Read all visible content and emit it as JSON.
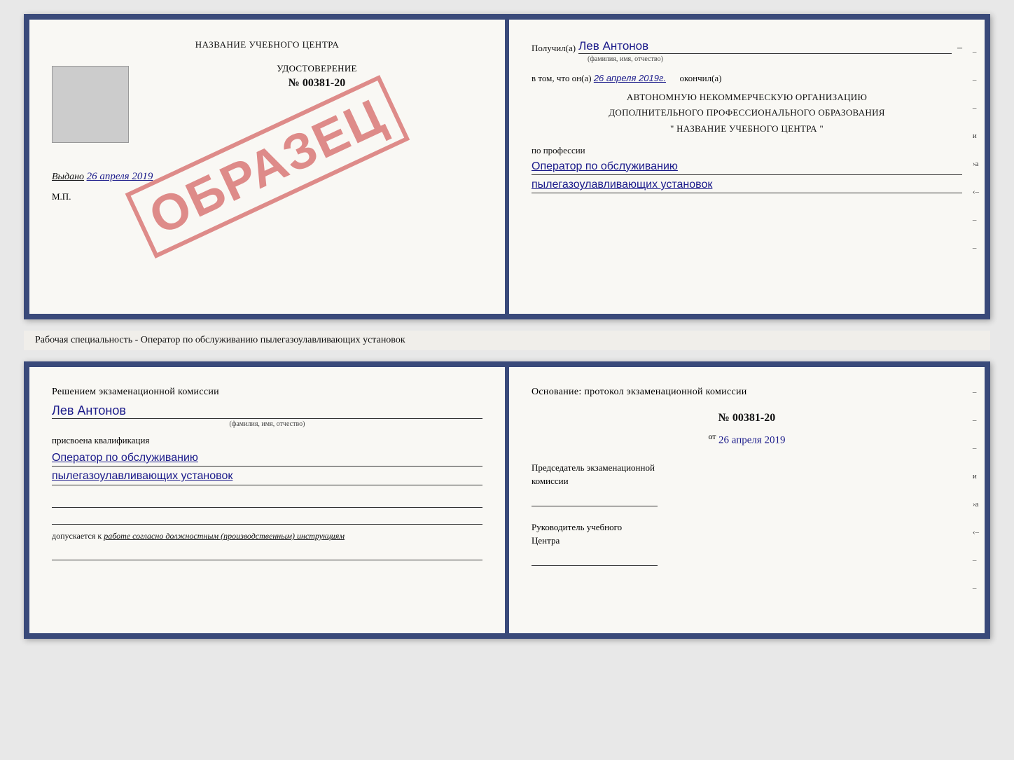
{
  "top_spread": {
    "left_page": {
      "header": "НАЗВАНИЕ УЧЕБНОГО ЦЕНТРА",
      "udostoverenie_label": "УДОСТОВЕРЕНИЕ",
      "number": "№ 00381-20",
      "issued_label": "Выдано",
      "issued_date": "26 апреля 2019",
      "mp_label": "М.П.",
      "stamp": "ОБРАЗЕЦ"
    },
    "right_page": {
      "received_label": "Получил(а)",
      "recipient_name": "Лев Антонов",
      "fio_hint": "(фамилия, имя, отчество)",
      "dash": "–",
      "date_prefix": "в том, что он(а)",
      "date_value": "26 апреля 2019г.",
      "finished_label": "окончил(а)",
      "org_line1": "АВТОНОМНУЮ НЕКОММЕРЧЕСКУЮ ОРГАНИЗАЦИЮ",
      "org_line2": "ДОПОЛНИТЕЛЬНОГО ПРОФЕССИОНАЛЬНОГО ОБРАЗОВАНИЯ",
      "org_line3": "\" НАЗВАНИЕ УЧЕБНОГО ЦЕНТРА \"",
      "profession_label": "по профессии",
      "profession_line1": "Оператор по обслуживанию",
      "profession_line2": "пылегазоулавливающих установок",
      "side_marks": [
        "–",
        "–",
        "–",
        "и",
        "›а",
        "‹–",
        "–",
        "–",
        "–"
      ]
    }
  },
  "middle_label": "Рабочая специальность - Оператор по обслуживанию пылегазоулавливающих установок",
  "bottom_spread": {
    "left_page": {
      "commission_header": "Решением экзаменационной комиссии",
      "person_name": "Лев Антонов",
      "fio_hint": "(фамилия, имя, отчество)",
      "qualification_label": "присвоена квалификация",
      "qualification_line1": "Оператор по обслуживанию",
      "qualification_line2": "пылегазоулавливающих установок",
      "admission_prefix": "допускается к",
      "admission_italic": "работе согласно должностным (производственным) инструкциям"
    },
    "right_page": {
      "osnov_label": "Основание: протокол экзаменационной комиссии",
      "protocol_number": "№ 00381-20",
      "date_prefix": "от",
      "date_value": "26 апреля 2019",
      "chairman_label1": "Председатель экзаменационной",
      "chairman_label2": "комиссии",
      "head_label1": "Руководитель учебного",
      "head_label2": "Центра",
      "side_marks": [
        "–",
        "–",
        "–",
        "и",
        "›а",
        "‹–",
        "–",
        "–",
        "–"
      ]
    }
  }
}
